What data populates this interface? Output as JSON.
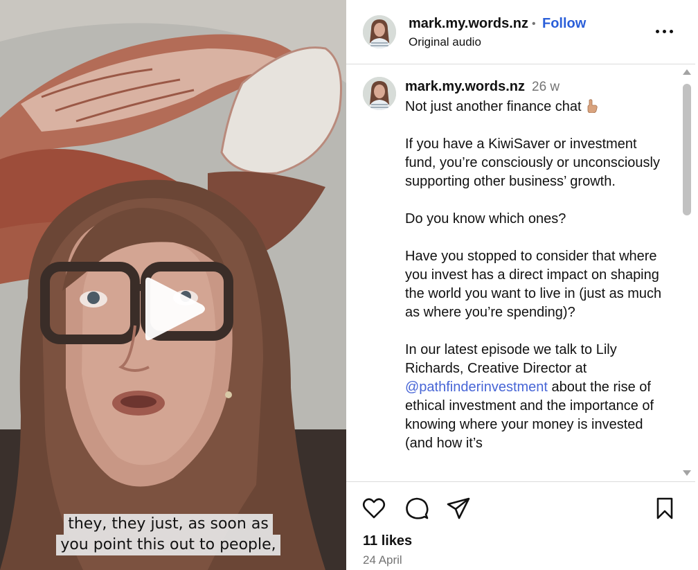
{
  "video": {
    "caption_lines": [
      "they, they just, as soon as",
      "you point this out to people,"
    ],
    "play_icon": "play-icon"
  },
  "header": {
    "username": "mark.my.words.nz",
    "separator": "•",
    "follow_label": "Follow",
    "audio_label": "Original audio",
    "more_icon": "more-options-icon"
  },
  "caption": {
    "username": "mark.my.words.nz",
    "time": "26 w",
    "paragraphs": [
      {
        "text": "Not just another finance chat",
        "emoji": "pointing-up-hand"
      },
      {
        "text": "If you have a KiwiSaver or investment fund, you’re consciously or unconsciously supporting other business’ growth."
      },
      {
        "text": "Do you know which ones?"
      },
      {
        "text": "Have you stopped to consider that where you invest has a direct impact on shaping the world you want to live in (just as much as where you’re spending)?"
      },
      {
        "text_before": "In our latest episode we talk to Lily Richards, Creative Director at ",
        "mention": "@pathfinderinvestment",
        "text_after": " about the rise of ethical investment and the importance of knowing where your money is invested (and how it’s"
      }
    ]
  },
  "footer": {
    "icons": [
      "heart-icon",
      "comment-icon",
      "share-icon",
      "bookmark-icon"
    ],
    "likes": "11 likes",
    "date": "24 April"
  },
  "colors": {
    "follow": "#2b5fd9",
    "mention": "#4765d6",
    "muted": "#737373",
    "divider": "#dbdbdb"
  }
}
